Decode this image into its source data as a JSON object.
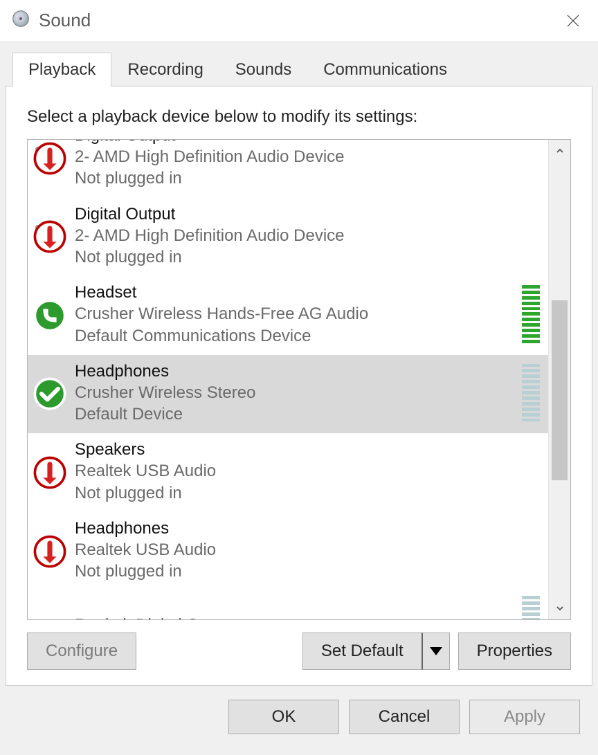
{
  "window": {
    "title": "Sound"
  },
  "tabs": {
    "playback": "Playback",
    "recording": "Recording",
    "sounds": "Sounds",
    "communications": "Communications"
  },
  "instruction": "Select a playback device below to modify its settings:",
  "devices": [
    {
      "name": "Digital Output",
      "subtitle": "2- AMD High Definition Audio Device",
      "status": "Not plugged in",
      "icon": "monitor",
      "badge": "disconnected",
      "selected": false,
      "meter": "none"
    },
    {
      "name": "Digital Output",
      "subtitle": "2- AMD High Definition Audio Device",
      "status": "Not plugged in",
      "icon": "monitor",
      "badge": "disconnected",
      "selected": false,
      "meter": "none"
    },
    {
      "name": "Headset",
      "subtitle": "Crusher Wireless Hands-Free AG Audio",
      "status": "Default Communications Device",
      "icon": "headset",
      "badge": "phone",
      "selected": false,
      "meter": "green"
    },
    {
      "name": "Headphones",
      "subtitle": "Crusher Wireless Stereo",
      "status": "Default Device",
      "icon": "headphones",
      "badge": "check",
      "selected": true,
      "meter": "grey"
    },
    {
      "name": "Speakers",
      "subtitle": "Realtek USB Audio",
      "status": "Not plugged in",
      "icon": "speaker",
      "badge": "disconnected",
      "selected": false,
      "meter": "none"
    },
    {
      "name": "Headphones",
      "subtitle": "Realtek USB Audio",
      "status": "Not plugged in",
      "icon": "headphones-grey",
      "badge": "disconnected",
      "selected": false,
      "meter": "none"
    },
    {
      "name": "Realtek Digital Output",
      "subtitle": "",
      "status": "",
      "icon": "none",
      "badge": "none",
      "selected": false,
      "meter": "grey"
    }
  ],
  "buttons": {
    "configure": "Configure",
    "set_default": "Set Default",
    "properties": "Properties",
    "ok": "OK",
    "cancel": "Cancel",
    "apply": "Apply"
  }
}
